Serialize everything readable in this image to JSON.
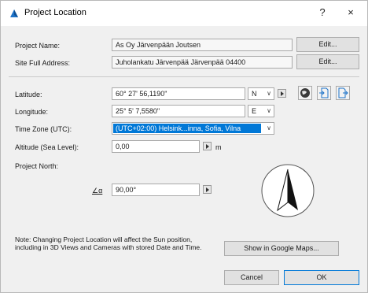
{
  "window": {
    "title": "Project Location",
    "help": "?",
    "close": "×"
  },
  "project_name": {
    "label": "Project Name:",
    "value": "As Oy Järvenpään Joutsen",
    "edit_label": "Edit..."
  },
  "site_address": {
    "label": "Site Full Address:",
    "value": "Juholankatu Järvenpää Järvenpää 04400",
    "edit_label": "Edit..."
  },
  "latitude": {
    "label": "Latitude:",
    "value": "60° 27' 56,1190\"",
    "hemisphere": "N"
  },
  "longitude": {
    "label": "Longitude:",
    "value": "25° 5' 7,5580\"",
    "hemisphere": "E"
  },
  "timezone": {
    "label": "Time Zone (UTC):",
    "value": "(UTC+02:00) Helsink...inna, Sofia, Vilna"
  },
  "altitude": {
    "label": "Altitude (Sea Level):",
    "value": "0,00",
    "unit": "m"
  },
  "project_north": {
    "label": "Project North:",
    "angle_symbol": "∠α",
    "value": "90,00°"
  },
  "note": "Note: Changing Project Location will affect the Sun position, including in 3D Views and Cameras with stored Date and Time.",
  "buttons": {
    "google_maps": "Show in Google Maps...",
    "cancel": "Cancel",
    "ok": "OK"
  },
  "icons": [
    "globe-icon",
    "import-icon",
    "export-icon"
  ],
  "colors": {
    "selection": "#0078d7",
    "window_bg": "#f0f0f0"
  }
}
